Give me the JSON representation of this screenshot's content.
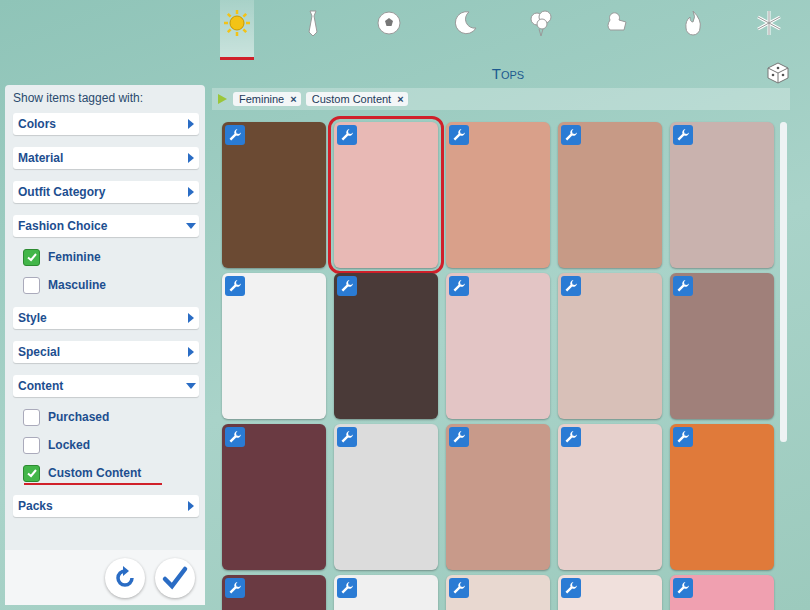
{
  "title": "Tops",
  "tabs": [
    {
      "kind": "everyday",
      "selected": true,
      "marked": true
    },
    {
      "kind": "formal",
      "selected": false,
      "marked": false
    },
    {
      "kind": "athletic",
      "selected": false,
      "marked": false
    },
    {
      "kind": "sleep",
      "selected": false,
      "marked": false
    },
    {
      "kind": "party",
      "selected": false,
      "marked": false
    },
    {
      "kind": "swimwear",
      "selected": false,
      "marked": false
    },
    {
      "kind": "hot",
      "selected": false,
      "marked": false
    },
    {
      "kind": "cold",
      "selected": false,
      "marked": false
    }
  ],
  "filter_chips": [
    {
      "label": "Feminine",
      "remove": "×"
    },
    {
      "label": "Custom Content",
      "remove": "×"
    }
  ],
  "sidebar": {
    "header": "Show items tagged with:",
    "groups": [
      {
        "label": "Colors",
        "expanded": false,
        "options": []
      },
      {
        "label": "Material",
        "expanded": false,
        "options": []
      },
      {
        "label": "Outfit Category",
        "expanded": false,
        "options": []
      },
      {
        "label": "Fashion Choice",
        "expanded": true,
        "options": [
          {
            "label": "Feminine",
            "checked": true,
            "marked": false
          },
          {
            "label": "Masculine",
            "checked": false,
            "marked": false
          }
        ]
      },
      {
        "label": "Style",
        "expanded": false,
        "options": []
      },
      {
        "label": "Special",
        "expanded": false,
        "options": []
      },
      {
        "label": "Content",
        "expanded": true,
        "options": [
          {
            "label": "Purchased",
            "checked": false,
            "marked": false
          },
          {
            "label": "Locked",
            "checked": false,
            "marked": false
          },
          {
            "label": "Custom Content",
            "checked": true,
            "marked": true
          }
        ]
      },
      {
        "label": "Packs",
        "expanded": false,
        "options": []
      }
    ]
  },
  "cards": [
    {
      "color": "#6b4a33",
      "custom": true,
      "marked": false
    },
    {
      "color": "#e8b9b5",
      "custom": true,
      "marked": true
    },
    {
      "color": "#d9a08a",
      "custom": true,
      "marked": false
    },
    {
      "color": "#c79a86",
      "custom": true,
      "marked": false
    },
    {
      "color": "#c9b2ae",
      "custom": true,
      "marked": false
    },
    {
      "color": "#f2f2f2",
      "custom": true,
      "marked": false
    },
    {
      "color": "#4a3a38",
      "custom": true,
      "marked": false
    },
    {
      "color": "#e3c5c5",
      "custom": true,
      "marked": false
    },
    {
      "color": "#d8c0b8",
      "custom": true,
      "marked": false
    },
    {
      "color": "#a0807a",
      "custom": true,
      "marked": false
    },
    {
      "color": "#6a3a42",
      "custom": true,
      "marked": false
    },
    {
      "color": "#dcdcdc",
      "custom": true,
      "marked": false
    },
    {
      "color": "#c89a8a",
      "custom": true,
      "marked": false
    },
    {
      "color": "#e6d0cc",
      "custom": true,
      "marked": false
    },
    {
      "color": "#e07a3a",
      "custom": true,
      "marked": false
    },
    {
      "color": "#6a3a42",
      "custom": true,
      "marked": false
    },
    {
      "color": "#f0f0f0",
      "custom": true,
      "marked": false
    },
    {
      "color": "#e8d8d0",
      "custom": true,
      "marked": false
    },
    {
      "color": "#f0e0dc",
      "custom": true,
      "marked": false
    },
    {
      "color": "#f0a0b0",
      "custom": true,
      "marked": false
    }
  ]
}
